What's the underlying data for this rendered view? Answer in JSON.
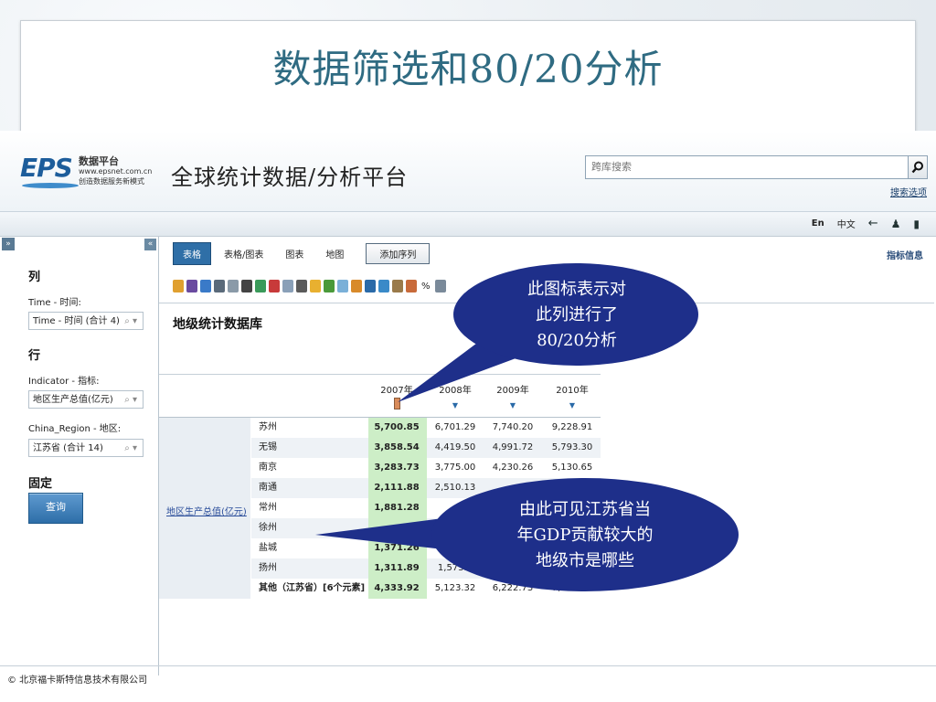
{
  "slide": {
    "title": "数据筛选和80/20分析"
  },
  "header": {
    "logo_text": "EPS",
    "logo_line1": "数据平台",
    "logo_line2": "www.epsnet.com.cn",
    "logo_line3": "创造数据服务新模式",
    "platform_title": "全球统计数据/分析平台",
    "search_placeholder": "跨库搜索",
    "search_options": "搜索选项"
  },
  "subbar": {
    "lang_en": "En",
    "lang_cn": "中文"
  },
  "left_panel": {
    "col_section": "列",
    "time_label": "Time - 时间:",
    "time_value": "Time - 时间 (合计 4)",
    "row_section": "行",
    "indicator_label": "Indicator - 指标:",
    "indicator_value": "地区生产总值(亿元)",
    "region_label": "China_Region - 地区:",
    "region_value": "江苏省 (合计 14)",
    "fixed_section": "固定",
    "query_button": "查询"
  },
  "tabs": [
    {
      "label": "表格",
      "active": true
    },
    {
      "label": "表格/图表",
      "active": false
    },
    {
      "label": "图表",
      "active": false
    },
    {
      "label": "地图",
      "active": false
    }
  ],
  "add_series": "添加序列",
  "indicator_info": "指标信息",
  "toolbar_percent": "%",
  "db_title": "地级统计数据库",
  "table": {
    "indicator": "地区生产总值(亿元)",
    "years": [
      "2007年",
      "2008年",
      "2009年",
      "2010年"
    ],
    "rows": [
      {
        "city": "苏州",
        "values": [
          "5,700.85",
          "6,701.29",
          "7,740.20",
          "9,228.91"
        ]
      },
      {
        "city": "无锡",
        "values": [
          "3,858.54",
          "4,419.50",
          "4,991.72",
          "5,793.30"
        ]
      },
      {
        "city": "南京",
        "values": [
          "3,283.73",
          "3,775.00",
          "4,230.26",
          "5,130.65"
        ]
      },
      {
        "city": "南通",
        "values": [
          "2,111.88",
          "2,510.13",
          "",
          ""
        ]
      },
      {
        "city": "常州",
        "values": [
          "1,881.28",
          "",
          "",
          ""
        ]
      },
      {
        "city": "徐州",
        "values": [
          "",
          "",
          "",
          ""
        ]
      },
      {
        "city": "盐城",
        "values": [
          "1,371.26",
          "",
          "",
          ""
        ]
      },
      {
        "city": "扬州",
        "values": [
          "1,311.89",
          "1,573.2",
          "",
          ""
        ]
      },
      {
        "city": "其他（江苏省）[6个元素]",
        "values": [
          "4,333.92",
          "5,123.32",
          "6,222.73",
          "7,081.83"
        ]
      }
    ]
  },
  "callouts": {
    "top": [
      "此图标表示对",
      "此列进行了",
      "80/20分析"
    ],
    "bottom": [
      "由此可见江苏省当",
      "年GDP贡献较大的",
      "地级市是哪些"
    ]
  },
  "copyright": "© 北京福卡斯特信息技术有限公司",
  "colors": {
    "callout_fill": "#1e2f8a",
    "header_blue": "#2f6fa7",
    "title_color": "#2f6b82",
    "highlight_green": "#cdeec7"
  }
}
